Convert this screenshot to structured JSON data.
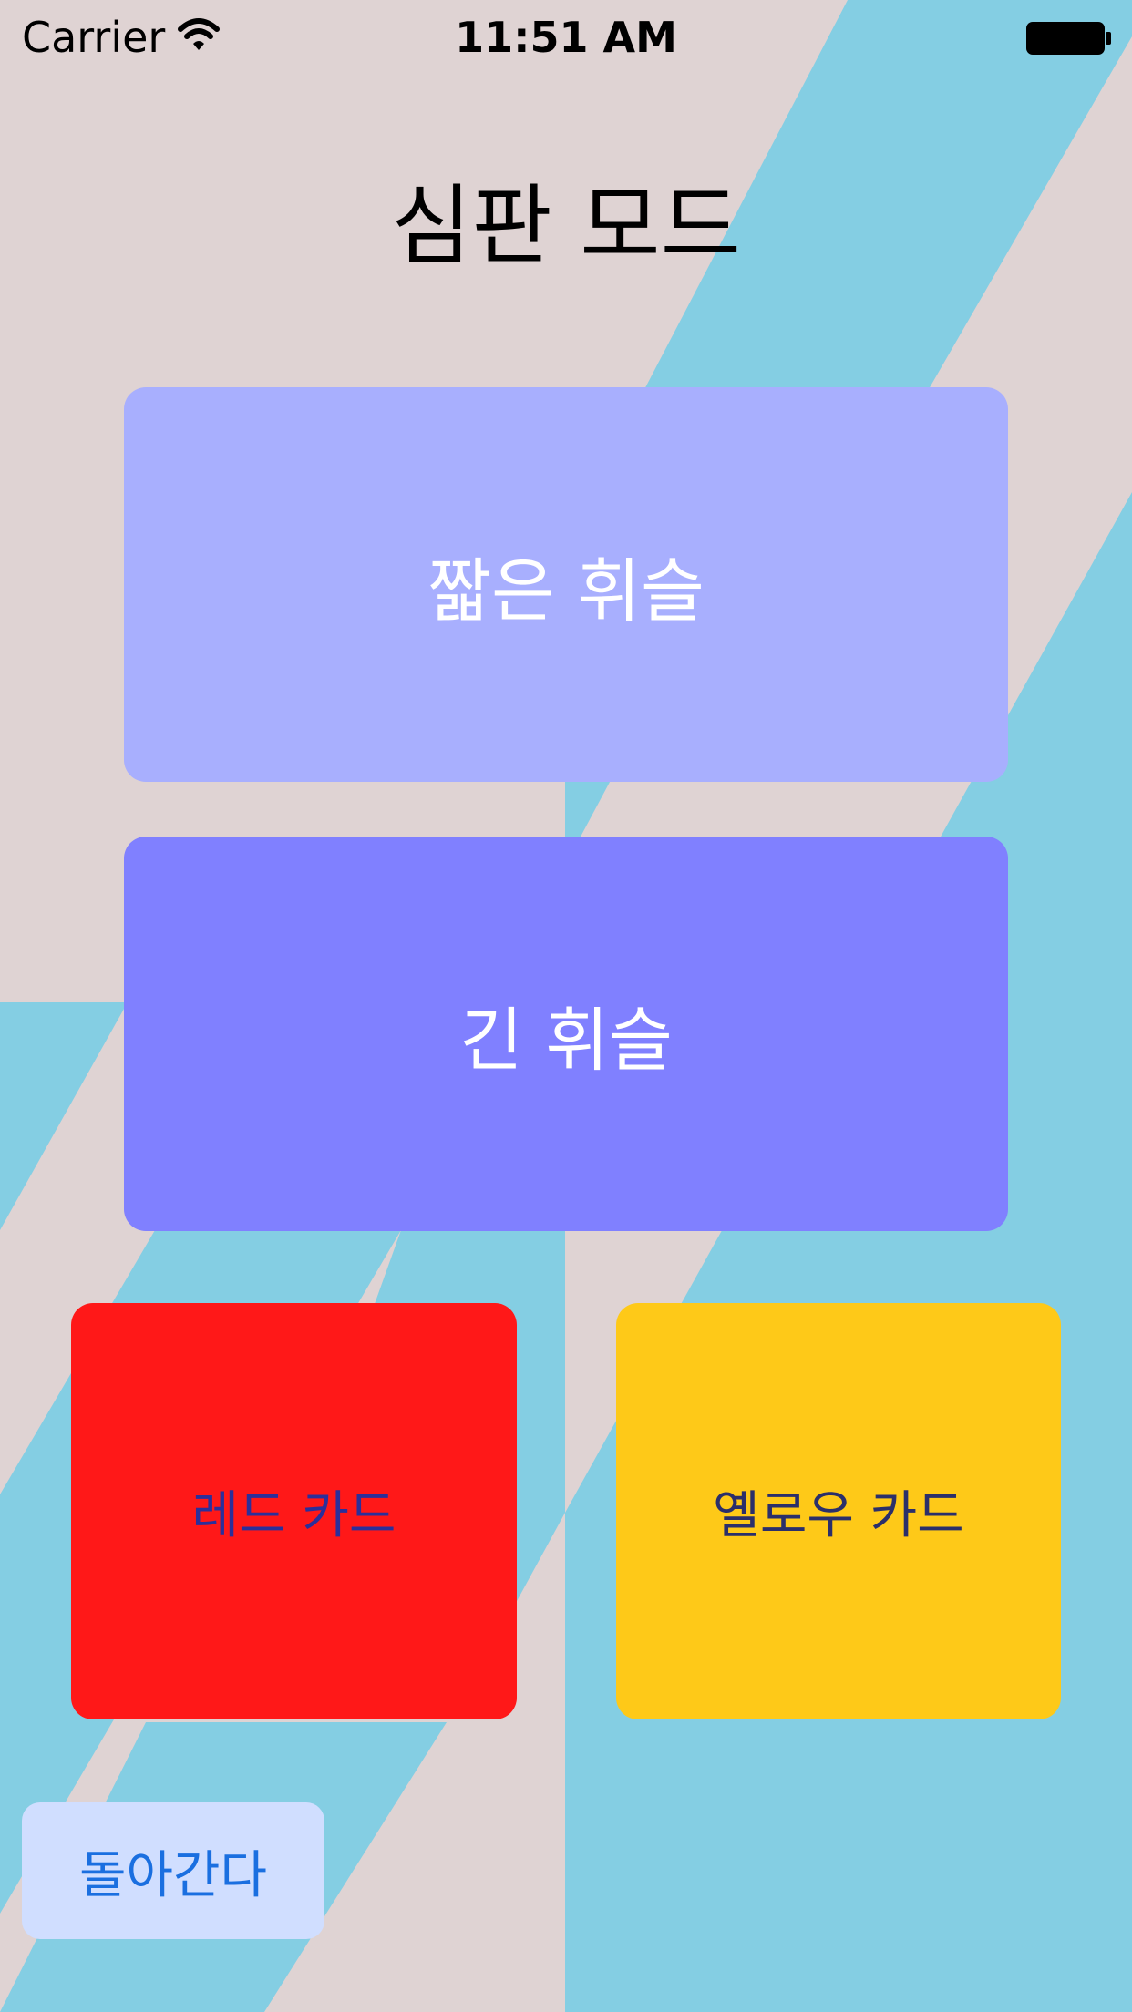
{
  "status_bar": {
    "carrier": "Carrier",
    "time": "11:51 AM"
  },
  "title": "심판 모드",
  "buttons": {
    "short_whistle": "짧은 휘슬",
    "long_whistle": "긴 휘슬",
    "red_card": "레드 카드",
    "yellow_card": "옐로우 카드",
    "back": "돌아간다"
  },
  "colors": {
    "background": "#dfd3d3",
    "stripe": "#84cee3",
    "short_whistle": "#a8affe",
    "long_whistle": "#8080ff",
    "red_card": "#ff1818",
    "yellow_card": "#fec918",
    "back": "#d0deff",
    "back_text": "#1a6fe0"
  },
  "icons": {
    "wifi": "wifi-icon",
    "battery": "battery-icon"
  }
}
